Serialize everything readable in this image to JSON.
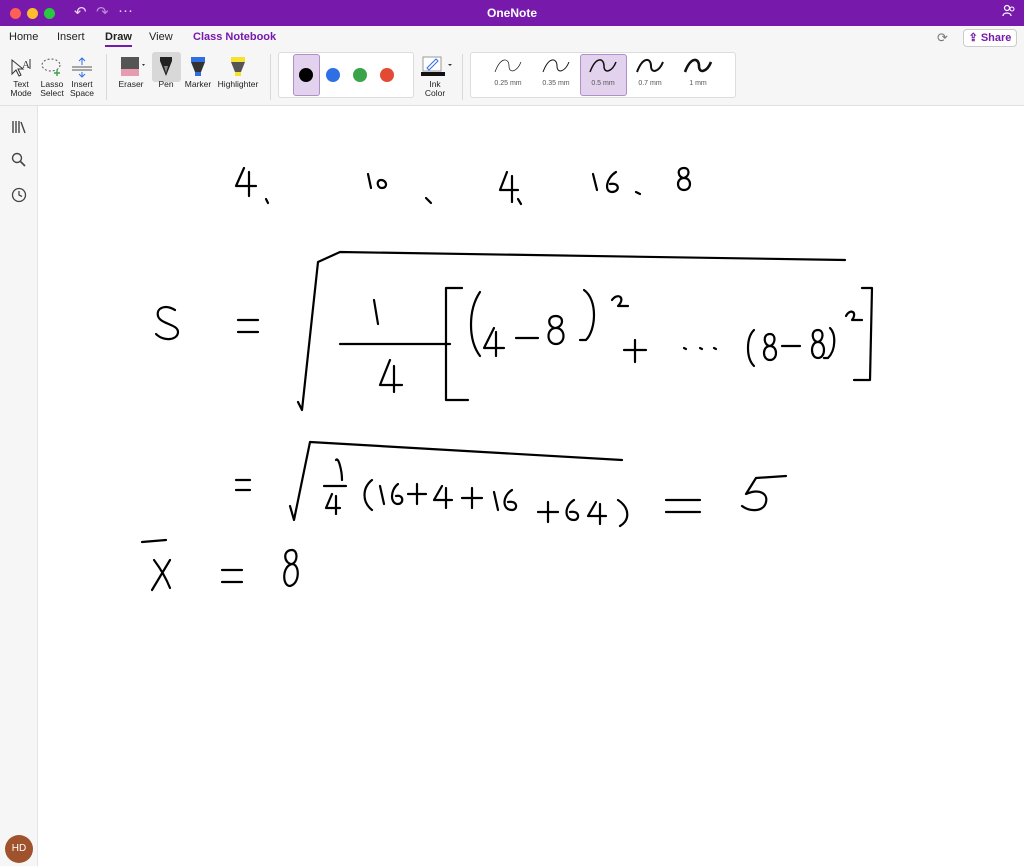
{
  "window": {
    "title": "OneNote"
  },
  "tabs": [
    {
      "label": "Home"
    },
    {
      "label": "Insert"
    },
    {
      "label": "Draw"
    },
    {
      "label": "View"
    },
    {
      "label": "Class Notebook"
    }
  ],
  "share": {
    "label": "Share"
  },
  "ribbon": {
    "text_mode": "Text Mode",
    "lasso_select": "Lasso Select",
    "insert_space": "Insert Space",
    "eraser": "Eraser",
    "pen": "Pen",
    "marker": "Marker",
    "highlighter": "Highlighter",
    "ink_color": "Ink Color",
    "pen_colors": [
      "#000000",
      "#2f6fe4",
      "#3aa34a",
      "#e24a33"
    ],
    "thickness": [
      {
        "label": "0.25 mm"
      },
      {
        "label": "0.35 mm"
      },
      {
        "label": "0.5 mm",
        "selected": true
      },
      {
        "label": "0.7 mm"
      },
      {
        "label": "1 mm"
      }
    ]
  },
  "user": {
    "initials": "HD"
  },
  "colors": {
    "accent": "#7719aa",
    "avatar": "#a0522d"
  }
}
